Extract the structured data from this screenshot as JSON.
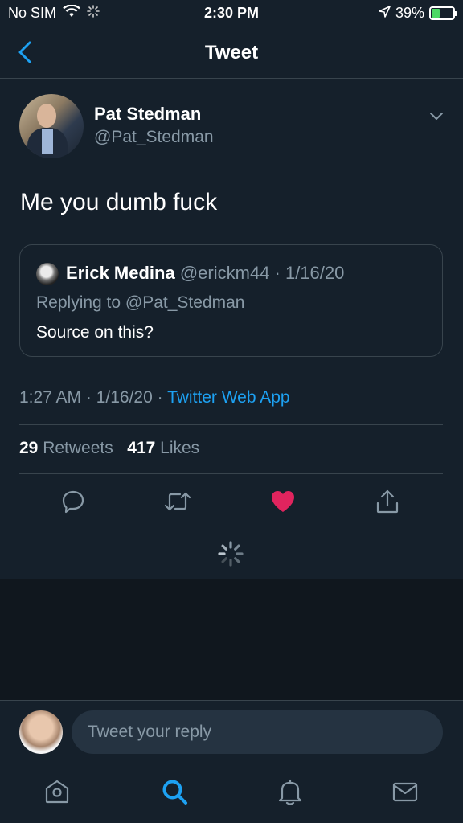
{
  "status_bar": {
    "carrier": "No SIM",
    "time": "2:30 PM",
    "battery_percent": "39%",
    "battery_level": 0.39,
    "battery_color": "#4cd964",
    "icons": [
      "wifi-icon",
      "loading-icon",
      "location-arrow-icon",
      "battery-charging-icon"
    ]
  },
  "header": {
    "title": "Tweet",
    "back_icon": "chevron-left-icon"
  },
  "tweet": {
    "author_name": "Pat Stedman",
    "author_handle": "@Pat_Stedman",
    "text": "Me you dumb fuck",
    "quoted": {
      "name": "Erick Medina",
      "handle_date": "@erickm44 · 1/16/20",
      "replying_to": "Replying to @Pat_Stedman",
      "text": "Source on this?"
    },
    "timestamp": "1:27 AM · 1/16/20 · ",
    "source": "Twitter Web App",
    "retweets_count": "29",
    "retweets_label": "Retweets",
    "likes_count": "417",
    "likes_label": "Likes",
    "actions": [
      "reply-icon",
      "retweet-icon",
      "like-icon",
      "share-icon"
    ]
  },
  "reply_bar": {
    "placeholder": "Tweet your reply"
  },
  "tab_bar": {
    "tabs": [
      "home-icon",
      "search-icon",
      "notifications-icon",
      "messages-icon"
    ],
    "active": "search-icon"
  },
  "colors": {
    "background": "#15202b",
    "accent": "#1da1f2",
    "like": "#e0245e",
    "muted": "#8899a6"
  }
}
